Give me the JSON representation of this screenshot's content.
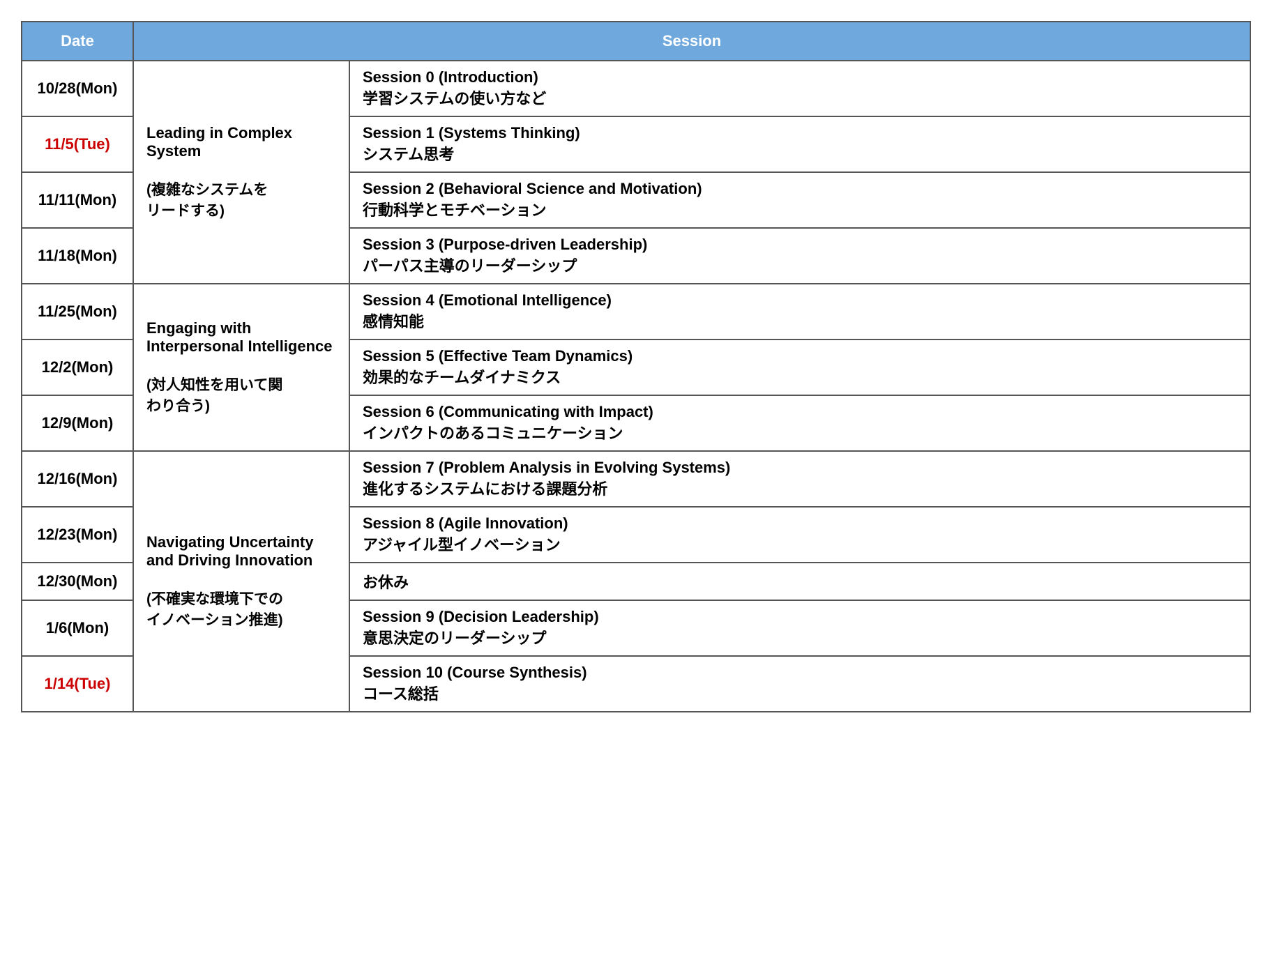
{
  "header": {
    "col_date": "Date",
    "col_session": "Session"
  },
  "rows": [
    {
      "date": "10/28(Mon)",
      "date_red": false,
      "module": "Leading in Complex System\n\n(複雑なシステムを\nリードする)",
      "module_en": "Leading in Complex System",
      "module_ja": "(複雑なシステムを\nリードする)",
      "module_rowspan": 4,
      "session_en": "Session 0 (Introduction)",
      "session_ja": "学習システムの使い方など"
    },
    {
      "date": "11/5(Tue)",
      "date_red": true,
      "session_en": "Session 1  (Systems Thinking)",
      "session_ja": "システム思考"
    },
    {
      "date": "11/11(Mon)",
      "date_red": false,
      "session_en": "Session 2 (Behavioral Science and Motivation)",
      "session_ja": "行動科学とモチベーション"
    },
    {
      "date": "11/18(Mon)",
      "date_red": false,
      "session_en": "Session 3 (Purpose-driven Leadership)",
      "session_ja": "パーパス主導のリーダーシップ"
    },
    {
      "date": "11/25(Mon)",
      "date_red": false,
      "module_en": "Engaging with Interpersonal Intelligence",
      "module_ja": "(対人知性を用いて関\nわり合う)",
      "module_rowspan": 3,
      "session_en": "Session 4 (Emotional Intelligence)",
      "session_ja": "感情知能"
    },
    {
      "date": "12/2(Mon)",
      "date_red": false,
      "session_en": "Session 5 (Effective Team Dynamics)",
      "session_ja": "効果的なチームダイナミクス"
    },
    {
      "date": "12/9(Mon)",
      "date_red": false,
      "session_en": "Session 6 (Communicating with Impact)",
      "session_ja": "インパクトのあるコミュニケーション"
    },
    {
      "date": "12/16(Mon)",
      "date_red": false,
      "module_en": "Navigating Uncertainty and Driving Innovation",
      "module_ja": "(不確実な環境下での\nイノベーション推進)",
      "module_rowspan": 5,
      "session_en": "Session 7 (Problem Analysis in Evolving Systems)",
      "session_ja": "進化するシステムにおける課題分析"
    },
    {
      "date": "12/23(Mon)",
      "date_red": false,
      "session_en": "Session 8 (Agile Innovation)",
      "session_ja": "アジャイル型イノベーション"
    },
    {
      "date": "12/30(Mon)",
      "date_red": false,
      "session_en": "お休み",
      "session_ja": ""
    },
    {
      "date": "1/6(Mon)",
      "date_red": false,
      "session_en": "Session 9 (Decision Leadership)",
      "session_ja": "意思決定のリーダーシップ"
    },
    {
      "date": "1/14(Tue)",
      "date_red": true,
      "session_en": "Session 10 (Course Synthesis)",
      "session_ja": "コース総括"
    }
  ]
}
